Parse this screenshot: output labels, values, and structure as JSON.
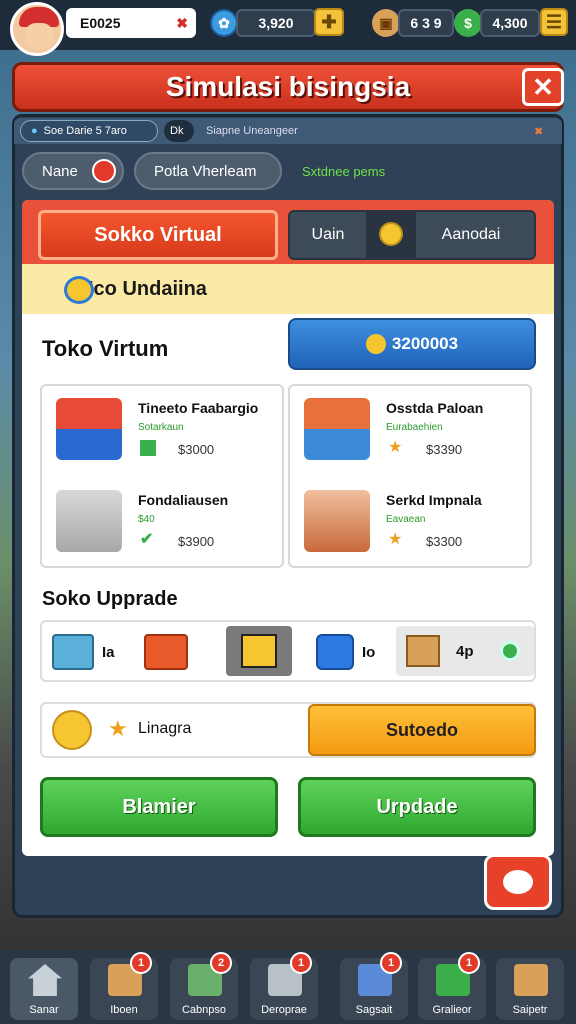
{
  "header": {
    "player_id": "E0025",
    "currency1": "3,920",
    "currency2": "6 3 9",
    "currency3": "4,300",
    "plus": "+"
  },
  "title": "Simulasi bisingsia",
  "close": "✕",
  "subbar": {
    "chip1": "Soe Darie 5 7aro",
    "chip2": "Dk",
    "chip3": "Siapne Uneangeer"
  },
  "tabs": {
    "name": "Nane",
    "portal": "Potla Vherleam",
    "status": "Sxtdnee pems"
  },
  "bigtabs": {
    "left": "Sokko Virtual",
    "mid": "Uain",
    "right": "Aanodai"
  },
  "banner": "Ico Undaiina",
  "section1": {
    "title": "Toko Virtum",
    "price": "3200003"
  },
  "items": [
    {
      "name": "Tineeto Faabargio",
      "sub": "Sotarkaun",
      "price": "$3000"
    },
    {
      "name": "Fondaliausen",
      "sub": "$40",
      "price": "$3900"
    },
    {
      "name": "Osstda Paloan",
      "sub": "Eurabaehien",
      "price": "$3390"
    },
    {
      "name": "Serkd Impnala",
      "sub": "Eavaean",
      "price": "$3300"
    }
  ],
  "section2": {
    "title": "Soko Upprade"
  },
  "upgrades": {
    "a": "Ia",
    "b": "Io",
    "c": "4p"
  },
  "bottom": {
    "left": "Linagra",
    "right": "Sutoedo"
  },
  "buttons": {
    "left": "Blamier",
    "right": "Urpdade"
  },
  "nav": [
    {
      "label": "Sanar",
      "badge": ""
    },
    {
      "label": "Iboen",
      "badge": "1"
    },
    {
      "label": "Cabnpso",
      "badge": "2"
    },
    {
      "label": "Deroprae",
      "badge": "1"
    },
    {
      "label": "Sagsait",
      "badge": "1"
    },
    {
      "label": "Gralieor",
      "badge": "1"
    },
    {
      "label": "Saipetr",
      "badge": ""
    }
  ]
}
